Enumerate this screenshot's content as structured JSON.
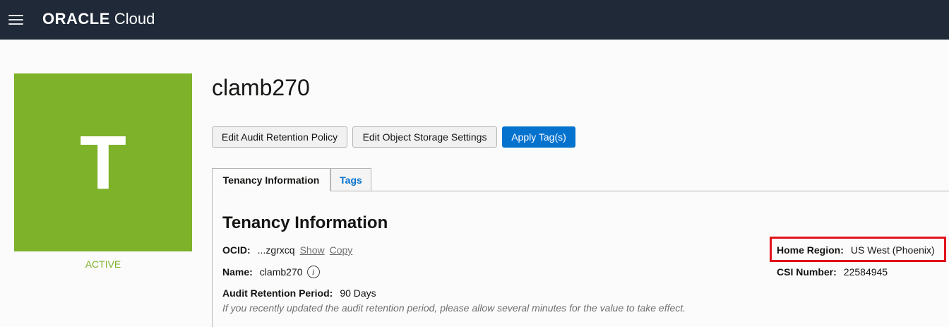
{
  "header": {
    "brand_oracle": "ORACLE",
    "brand_cloud": "Cloud",
    "menu_icon": "hamburger-menu-icon"
  },
  "tenancy_tile": {
    "letter": "T",
    "color": "#7db22a",
    "status": "ACTIVE"
  },
  "page": {
    "title": "clamb270"
  },
  "actions": {
    "edit_audit": "Edit Audit Retention Policy",
    "edit_storage": "Edit Object Storage Settings",
    "apply_tags": "Apply Tag(s)"
  },
  "tabs": [
    {
      "label": "Tenancy Information",
      "active": true
    },
    {
      "label": "Tags",
      "active": false
    }
  ],
  "info": {
    "section_title": "Tenancy Information",
    "ocid_label": "OCID:",
    "ocid_value": "...zgrxcq",
    "show_link": "Show",
    "copy_link": "Copy",
    "name_label": "Name:",
    "name_value": "clamb270",
    "audit_label": "Audit Retention Period:",
    "audit_value": "90 Days",
    "audit_hint": "If you recently updated the audit retention period, please allow several minutes for the value to take effect.",
    "home_region_label": "Home Region:",
    "home_region_value": "US West (Phoenix)",
    "csi_label": "CSI Number:",
    "csi_value": "22584945"
  },
  "colors": {
    "accent_blue": "#0572ce",
    "highlight_red": "#e3121b",
    "header_bg": "#1f2937"
  }
}
